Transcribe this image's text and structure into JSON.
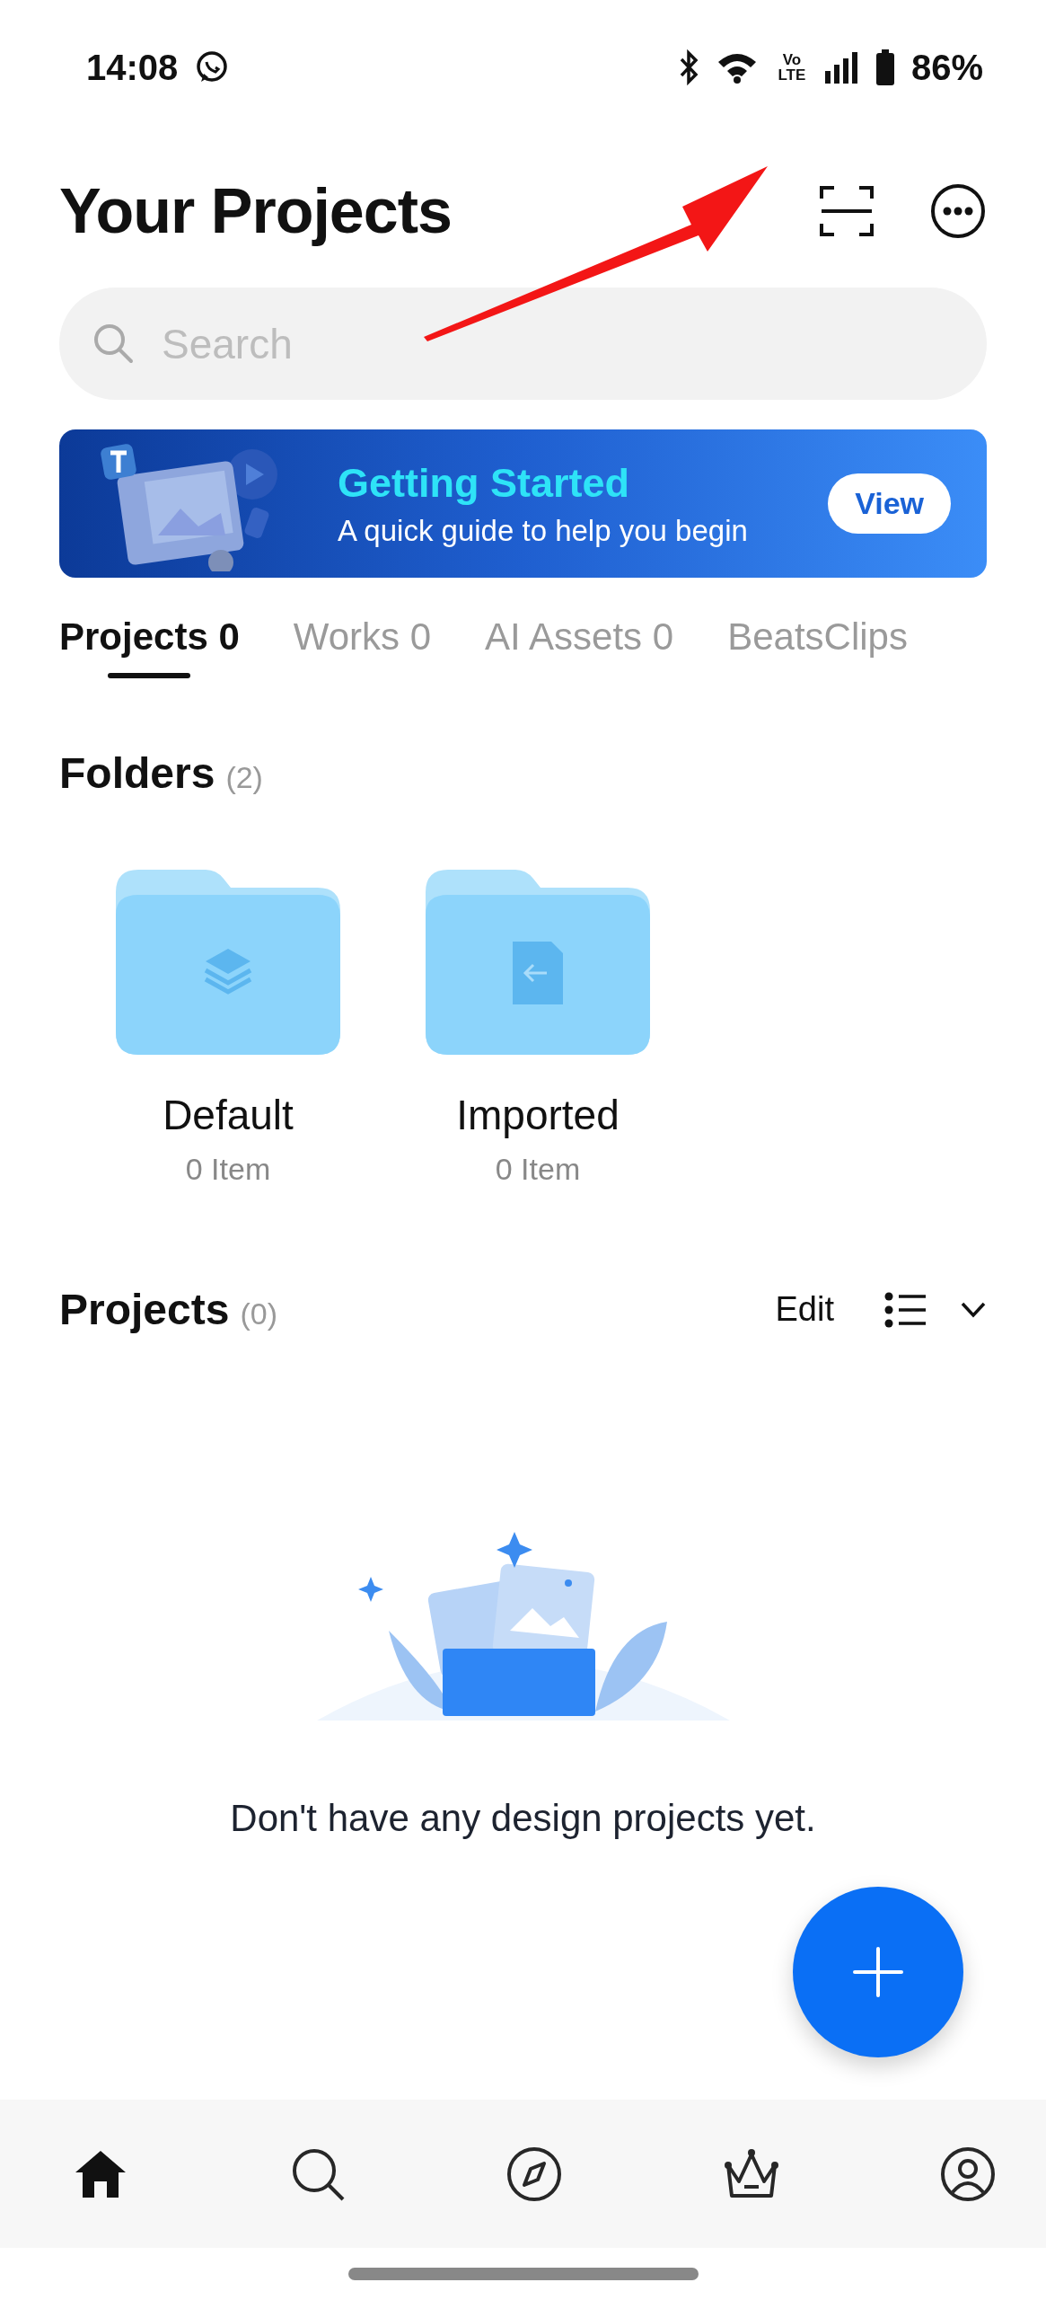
{
  "status_bar": {
    "time": "14:08",
    "network_label": "Vo LTE",
    "battery": "86%"
  },
  "header": {
    "title": "Your Projects"
  },
  "annotation": {
    "kind": "arrow"
  },
  "search": {
    "placeholder": "Search"
  },
  "banner": {
    "title": "Getting Started",
    "subtitle": "A quick guide to help you begin",
    "button": "View"
  },
  "tabs": [
    {
      "label": "Projects 0",
      "selected": true
    },
    {
      "label": "Works 0",
      "selected": false
    },
    {
      "label": "AI Assets 0",
      "selected": false
    },
    {
      "label": "BeatsClips",
      "selected": false
    }
  ],
  "folders": {
    "title": "Folders",
    "count": "(2)",
    "items": [
      {
        "name": "Default",
        "meta": "0 Item",
        "kind": "layers"
      },
      {
        "name": "Imported",
        "meta": "0 Item",
        "kind": "import"
      }
    ]
  },
  "projects": {
    "title": "Projects",
    "count": "(0)",
    "edit": "Edit",
    "empty_text": "Don't have any design projects yet."
  },
  "nav": [
    {
      "kind": "home",
      "selected": true
    },
    {
      "kind": "search",
      "selected": false
    },
    {
      "kind": "explore",
      "selected": false
    },
    {
      "kind": "premium",
      "selected": false
    },
    {
      "kind": "profile",
      "selected": false
    }
  ]
}
